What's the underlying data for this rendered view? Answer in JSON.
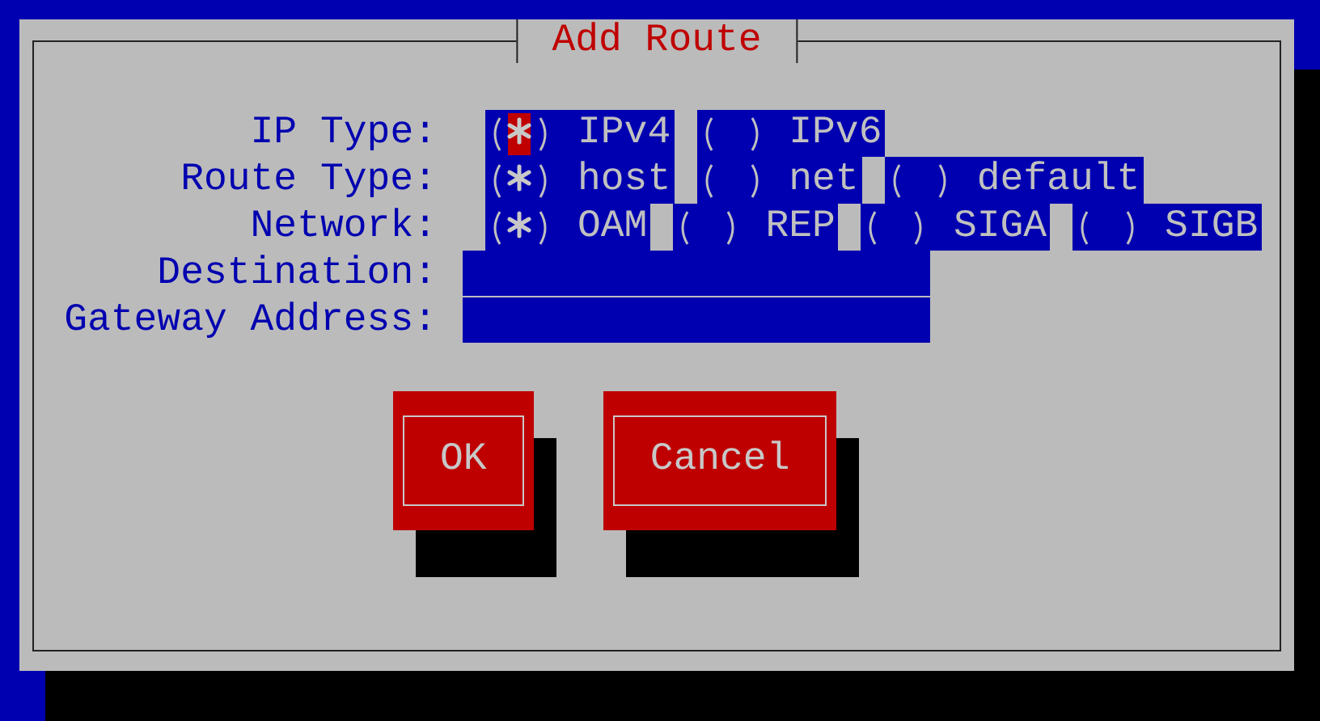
{
  "dialog": {
    "title": "Add Route",
    "fields": [
      {
        "kind": "radio",
        "label": "IP Type:",
        "options": [
          {
            "label": "IPv4",
            "selected": true,
            "focused": true
          },
          {
            "label": "IPv6",
            "selected": false,
            "focused": false
          }
        ]
      },
      {
        "kind": "radio",
        "label": "Route Type:",
        "options": [
          {
            "label": "host",
            "selected": true,
            "focused": false
          },
          {
            "label": "net",
            "selected": false,
            "focused": false
          },
          {
            "label": "default",
            "selected": false,
            "focused": false
          }
        ]
      },
      {
        "kind": "radio",
        "label": "Network:",
        "options": [
          {
            "label": "OAM",
            "selected": true,
            "focused": false
          },
          {
            "label": "REP",
            "selected": false,
            "focused": false
          },
          {
            "label": "SIGA",
            "selected": false,
            "focused": false
          },
          {
            "label": "SIGB",
            "selected": false,
            "focused": false
          }
        ]
      },
      {
        "kind": "text",
        "label": "Destination:"
      },
      {
        "kind": "text",
        "label": "Gateway Address:"
      }
    ],
    "buttons": [
      {
        "label": "OK"
      },
      {
        "label": "Cancel"
      }
    ]
  }
}
